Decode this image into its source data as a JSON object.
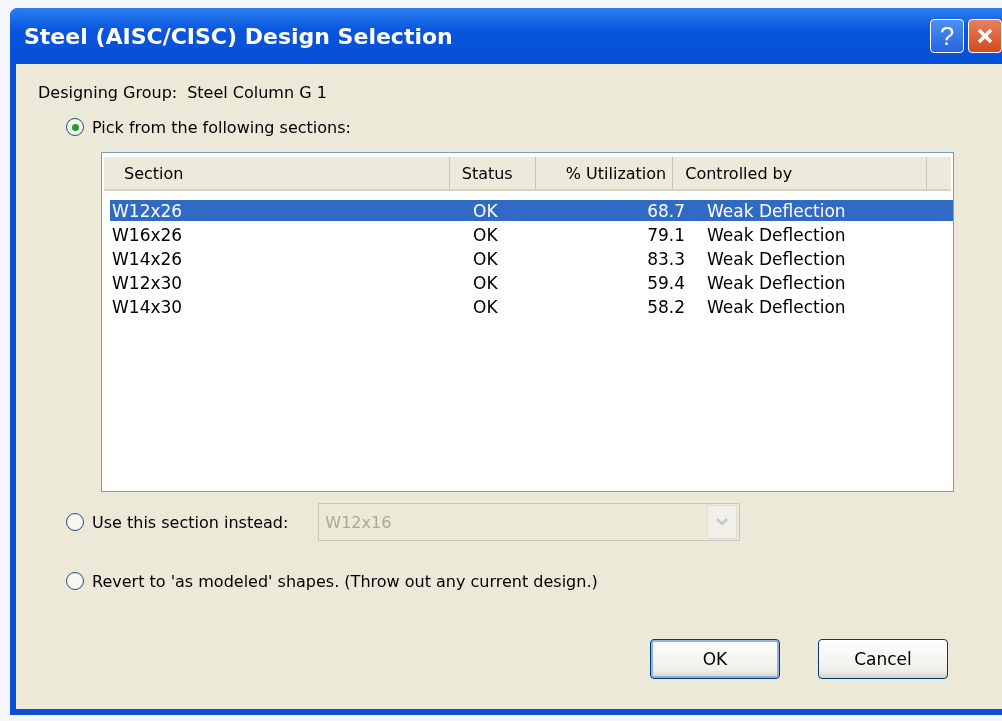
{
  "window": {
    "title": "Steel (AISC/CISC) Design Selection",
    "help_button": "?"
  },
  "designing_group": {
    "label": "Designing Group:",
    "value": "Steel Column G 1"
  },
  "options": [
    {
      "label": "Pick from the following sections:",
      "selected": true
    },
    {
      "label": "Use this section instead:",
      "selected": false
    },
    {
      "label": "Revert to 'as modeled' shapes. (Throw out any current design.)",
      "selected": false
    }
  ],
  "table": {
    "columns": [
      "Section",
      "Status",
      "% Utilization",
      "Controlled by"
    ],
    "rows": [
      {
        "cells": [
          "W12x26",
          "OK",
          "68.7",
          "Weak Deflection"
        ],
        "selected": true
      },
      {
        "cells": [
          "W16x26",
          "OK",
          "79.1",
          "Weak Deflection"
        ],
        "selected": false
      },
      {
        "cells": [
          "W14x26",
          "OK",
          "83.3",
          "Weak Deflection"
        ],
        "selected": false
      },
      {
        "cells": [
          "W12x30",
          "OK",
          "59.4",
          "Weak Deflection"
        ],
        "selected": false
      },
      {
        "cells": [
          "W14x30",
          "OK",
          "58.2",
          "Weak Deflection"
        ],
        "selected": false
      }
    ]
  },
  "section_combo": {
    "value": "W12x16",
    "disabled": true
  },
  "buttons": [
    "OK",
    "Cancel"
  ]
}
